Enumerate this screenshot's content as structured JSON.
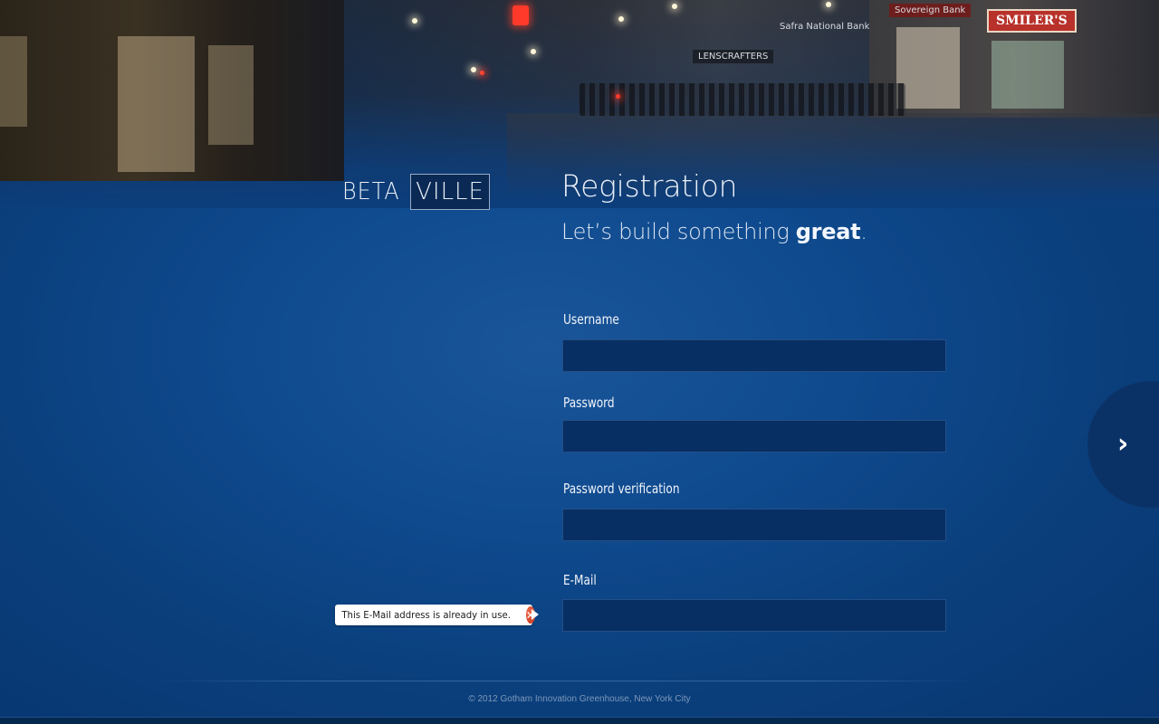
{
  "brand": {
    "logo_part1": "BETA",
    "logo_part2": "VILLE"
  },
  "header": {
    "title": "Registration",
    "tagline_prefix": "Let’s build something ",
    "tagline_emphasis": "great",
    "tagline_suffix": "."
  },
  "form": {
    "fields": [
      {
        "label": "Username",
        "value": "",
        "type": "text"
      },
      {
        "label": "Password",
        "value": "",
        "type": "password"
      },
      {
        "label": "Password verification",
        "value": "",
        "type": "password"
      },
      {
        "label": "E-Mail",
        "value": "",
        "type": "email"
      }
    ],
    "error": {
      "message": "This E-Mail address is already in use.",
      "icon": "error-x-icon",
      "icon_glyph": "✕",
      "color": "#d9452a"
    }
  },
  "navigation": {
    "next_icon": "chevron-right-icon",
    "next_glyph": "›"
  },
  "background_signs": {
    "smilers": "SMILER'S",
    "lenscrafters": "LENSCRAFTERS",
    "bank": "Safra National Bank",
    "sovereign": "Sovereign Bank"
  },
  "footer": {
    "copyright": "© 2012 Gotham Innovation Greenhouse, New York City"
  },
  "colors": {
    "background": "#0f4a8e",
    "input_bg": "#072f63",
    "next_button": "#0b3266",
    "text": "#f0f4fa"
  }
}
